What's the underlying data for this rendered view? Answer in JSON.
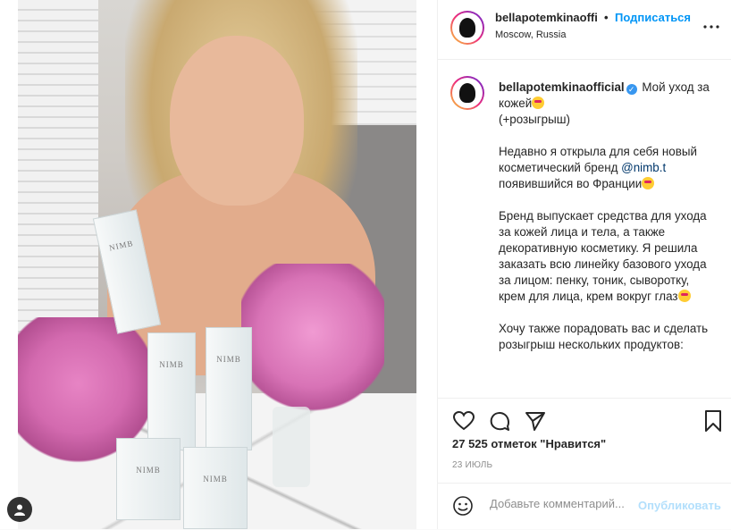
{
  "post": {
    "username": "bellapotemkinaoffi",
    "follow_label": "Подписаться",
    "separator": "•",
    "location": "Moscow, Russia",
    "more_icon": "more-horizontal-icon"
  },
  "caption": {
    "username": "bellapotemkinaofficial",
    "line1": "Мой уход за кожей",
    "line2": "(+розыгрыш)",
    "p1_a": "Недавно я открыла для себя новый косметический бренд ",
    "p1_mention": "@nimb.t",
    "p1_b": " появившийся во Франции",
    "p2": "Бренд выпускает средства для ухода за кожей лица и тела, а также декоративную косметику. Я решила заказать всю линейку базового ухода за лицом: пенку, тоник, сыворотку, крем для лица, крем вокруг глаз",
    "p3": "Хочу также порадовать вас и сделать розыгрыш нескольких продуктов:"
  },
  "photo": {
    "box_brand": "NIMB"
  },
  "actions": {
    "likes": "27 525 отметок \"Нравится\"",
    "date": "23 ИЮЛЬ"
  },
  "comment": {
    "placeholder": "Добавьте комментарий...",
    "post_label": "Опубликовать"
  },
  "colors": {
    "accent": "#0095f6",
    "post_disabled": "#b2dffc",
    "verified": "#3897f0"
  }
}
